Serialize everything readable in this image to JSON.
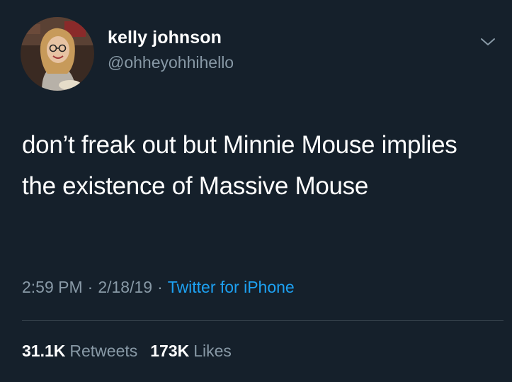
{
  "tweet": {
    "display_name": "kelly johnson",
    "handle": "@ohheyohhihello",
    "text": "don’t freak out but Minnie Mouse implies the existence of Massive Mouse",
    "time": "2:59 PM",
    "date": "2/18/19",
    "source": "Twitter for iPhone",
    "separator": "·",
    "caret_icon": "chevron-down-icon"
  },
  "stats": {
    "retweets_count": "31.1K",
    "retweets_label": "Retweets",
    "likes_count": "173K",
    "likes_label": "Likes"
  },
  "colors": {
    "background": "#15202b",
    "text_primary": "#ffffff",
    "text_secondary": "#8899a6",
    "link": "#1da1f2",
    "divider": "#38444d"
  }
}
